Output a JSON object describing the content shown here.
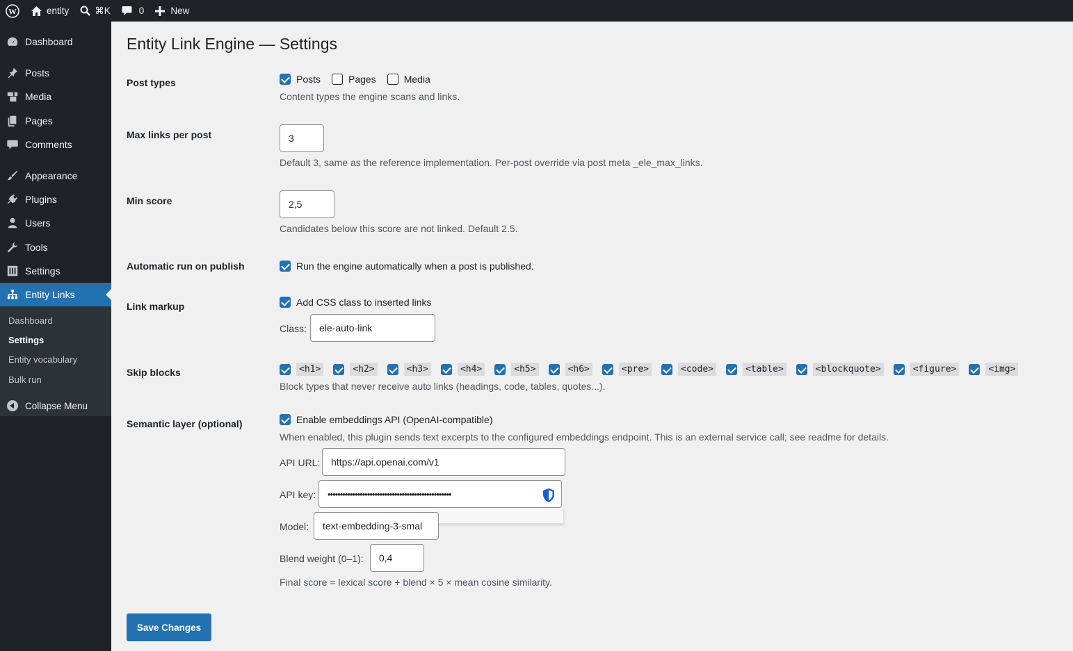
{
  "adminbar": {
    "site_name": "entity",
    "search_shortcut": "⌘K",
    "comments_count": "0",
    "new_label": "New"
  },
  "sidebar": {
    "items": [
      {
        "label": "Dashboard",
        "icon": "dashboard-icon"
      },
      {
        "label": "Posts",
        "icon": "pin-icon"
      },
      {
        "label": "Media",
        "icon": "media-icon"
      },
      {
        "label": "Pages",
        "icon": "pages-icon"
      },
      {
        "label": "Comments",
        "icon": "comment-icon"
      },
      {
        "label": "Appearance",
        "icon": "paintbrush-icon"
      },
      {
        "label": "Plugins",
        "icon": "plugin-icon"
      },
      {
        "label": "Users",
        "icon": "users-icon"
      },
      {
        "label": "Tools",
        "icon": "wrench-icon"
      },
      {
        "label": "Settings",
        "icon": "settings-icon"
      },
      {
        "label": "Entity Links",
        "icon": "sitemap-icon"
      }
    ],
    "submenu": [
      "Dashboard",
      "Settings",
      "Entity vocabulary",
      "Bulk run"
    ],
    "collapse_label": "Collapse Menu"
  },
  "page": {
    "title": "Entity Link Engine — Settings",
    "post_types": {
      "label": "Post types",
      "options": [
        {
          "label": "Posts",
          "checked": true
        },
        {
          "label": "Pages",
          "checked": false
        },
        {
          "label": "Media",
          "checked": false
        }
      ],
      "description": "Content types the engine scans and links."
    },
    "max_links": {
      "label": "Max links per post",
      "value": "3",
      "description": "Default 3, same as the reference implementation. Per-post override via post meta _ele_max_links."
    },
    "min_score": {
      "label": "Min score",
      "value": "2,5",
      "description": "Candidates below this score are not linked. Default 2.5."
    },
    "auto_run": {
      "label": "Automatic run on publish",
      "checkbox_label": "Run the engine automatically when a post is published.",
      "checked": true
    },
    "link_markup": {
      "label": "Link markup",
      "checkbox_label": "Add CSS class to inserted links",
      "checked": true,
      "class_label": "Class:",
      "class_value": "ele-auto-link"
    },
    "skip_blocks": {
      "label": "Skip blocks",
      "blocks": [
        "<h1>",
        "<h2>",
        "<h3>",
        "<h4>",
        "<h5>",
        "<h6>",
        "<pre>",
        "<code>",
        "<table>",
        "<blockquote>",
        "<figure>",
        "<img>"
      ],
      "description": "Block types that never receive auto links (headings, code, tables, quotes...)."
    },
    "semantic": {
      "label": "Semantic layer (optional)",
      "checkbox_label": "Enable embeddings API (OpenAI-compatible)",
      "checked": true,
      "description": "When enabled, this plugin sends text excerpts to the configured embeddings endpoint. This is an external service call; see readme for details.",
      "api_url_label": "API URL:",
      "api_url_value": "https://api.openai.com/v1",
      "api_key_label": "API key:",
      "api_key_value": "••••••••••••••••••••••••••••••••••••••••••••••••••",
      "model_label": "Model:",
      "model_value": "text-embedding-3-smal",
      "blend_label": "Blend weight (0–1):",
      "blend_value": "0,4",
      "formula": "Final score = lexical score + blend × 5 × mean cosine similarity."
    },
    "save_label": "Save Changes"
  },
  "colors": {
    "accent": "#2271b1",
    "adminbar": "#1d2327",
    "background": "#f0f0f1"
  }
}
